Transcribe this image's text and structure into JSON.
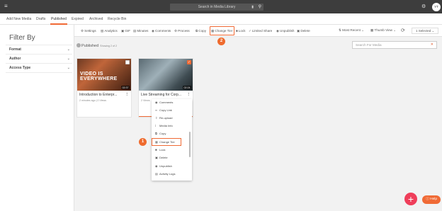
{
  "topbar": {
    "search_placeholder": "Search in Media Library",
    "mic_icon": "microphone-icon",
    "search_icon": "search-icon",
    "settings_icon": "gear-icon",
    "avatar_initials": "YT"
  },
  "tabs": [
    "Add New Media",
    "Drafts",
    "Published",
    "Expired",
    "Archived",
    "Recycle Bin"
  ],
  "active_tab": "Published",
  "sidebar": {
    "title": "Filter By",
    "filters": [
      "Format",
      "Author",
      "Access Type"
    ]
  },
  "toolbar": {
    "actions": [
      {
        "label": "Settings",
        "icon": "gear-icon"
      },
      {
        "label": "Analytics",
        "icon": "bar-chart-icon"
      },
      {
        "label": "GIF",
        "icon": "gif-icon"
      },
      {
        "label": "Minutes",
        "icon": "doc-icon"
      },
      {
        "label": "Comments",
        "icon": "comment-icon"
      },
      {
        "label": "Process",
        "icon": "gear-icon"
      },
      {
        "label": "Copy",
        "icon": "copy-icon"
      },
      {
        "label": "Change Tier",
        "icon": "tier-icon"
      },
      {
        "label": "Lock",
        "icon": "lock-icon"
      },
      {
        "label": "Limited Share",
        "icon": "share-icon"
      },
      {
        "label": "Unpublish",
        "icon": "unpublish-icon"
      },
      {
        "label": "Delete",
        "icon": "trash-icon"
      }
    ],
    "sort_label": "Most Recent",
    "view_label": "Thumb View",
    "selected_label": "1 Selected"
  },
  "content": {
    "status_label": "Published",
    "showing_text": "Showing 2 of 2",
    "search_placeholder": "Search For Media"
  },
  "cards": [
    {
      "title": "Introduction to Enterpr...",
      "meta": "2 minutes ago  |  0 Views",
      "duration": "02:37",
      "thumb_text": "VIDEO IS EVERYWHERE",
      "selected": false
    },
    {
      "title": "Live Streaming for Corp...",
      "meta": "2 Views",
      "duration": "02:24",
      "selected": true
    }
  ],
  "context_menu": {
    "items": [
      {
        "label": "Comments",
        "icon": "comment-icon"
      },
      {
        "label": "Copy Link",
        "icon": "link-icon"
      },
      {
        "label": "Re-upload",
        "icon": "upload-icon"
      },
      {
        "label": "Media Info",
        "icon": "info-icon"
      },
      {
        "label": "Copy",
        "icon": "copy-icon"
      },
      {
        "label": "Change Tier",
        "icon": "tier-icon"
      },
      {
        "label": "Lock",
        "icon": "lock-icon"
      },
      {
        "label": "Delete",
        "icon": "trash-icon"
      },
      {
        "label": "Unpublish",
        "icon": "unpublish-icon"
      },
      {
        "label": "Activity Logs",
        "icon": "activity-icon"
      }
    ]
  },
  "callouts": [
    "1",
    "2"
  ],
  "help_label": "Help",
  "colors": {
    "accent": "#f06a35",
    "fab": "#ef3e5a",
    "topbar": "#3d3d3d"
  }
}
